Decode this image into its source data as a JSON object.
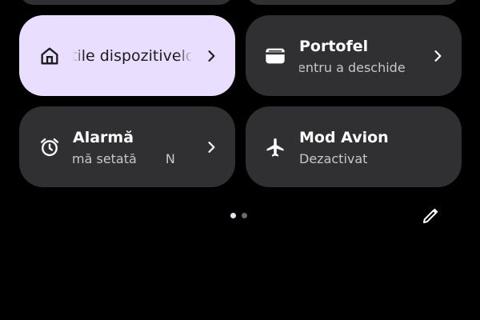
{
  "colors": {
    "background": "#000000",
    "tile_dark": "#303032",
    "tile_active": "#eadeff",
    "text_light": "#ffffff",
    "text_secondary": "#c8c6cc",
    "text_dark": "#1c1b1f",
    "dot_active": "#e6e1f0",
    "dot_inactive": "#6b6a70"
  },
  "tiles": {
    "devices": {
      "label": "tile dispozitivelo",
      "icon": "home-icon",
      "active": true
    },
    "wallet": {
      "label": "Portofel",
      "sub": "entru a deschide",
      "icon": "wallet-icon"
    },
    "alarm": {
      "label": "Alarmă",
      "sub": "mă setată",
      "sub_extra": "N",
      "icon": "alarm-clock-icon"
    },
    "airplane": {
      "label": "Mod Avion",
      "sub": "Dezactivat",
      "icon": "airplane-icon"
    }
  },
  "pager": {
    "page_count": 2,
    "current_page": 1
  },
  "edit": {
    "icon": "pencil-icon"
  }
}
